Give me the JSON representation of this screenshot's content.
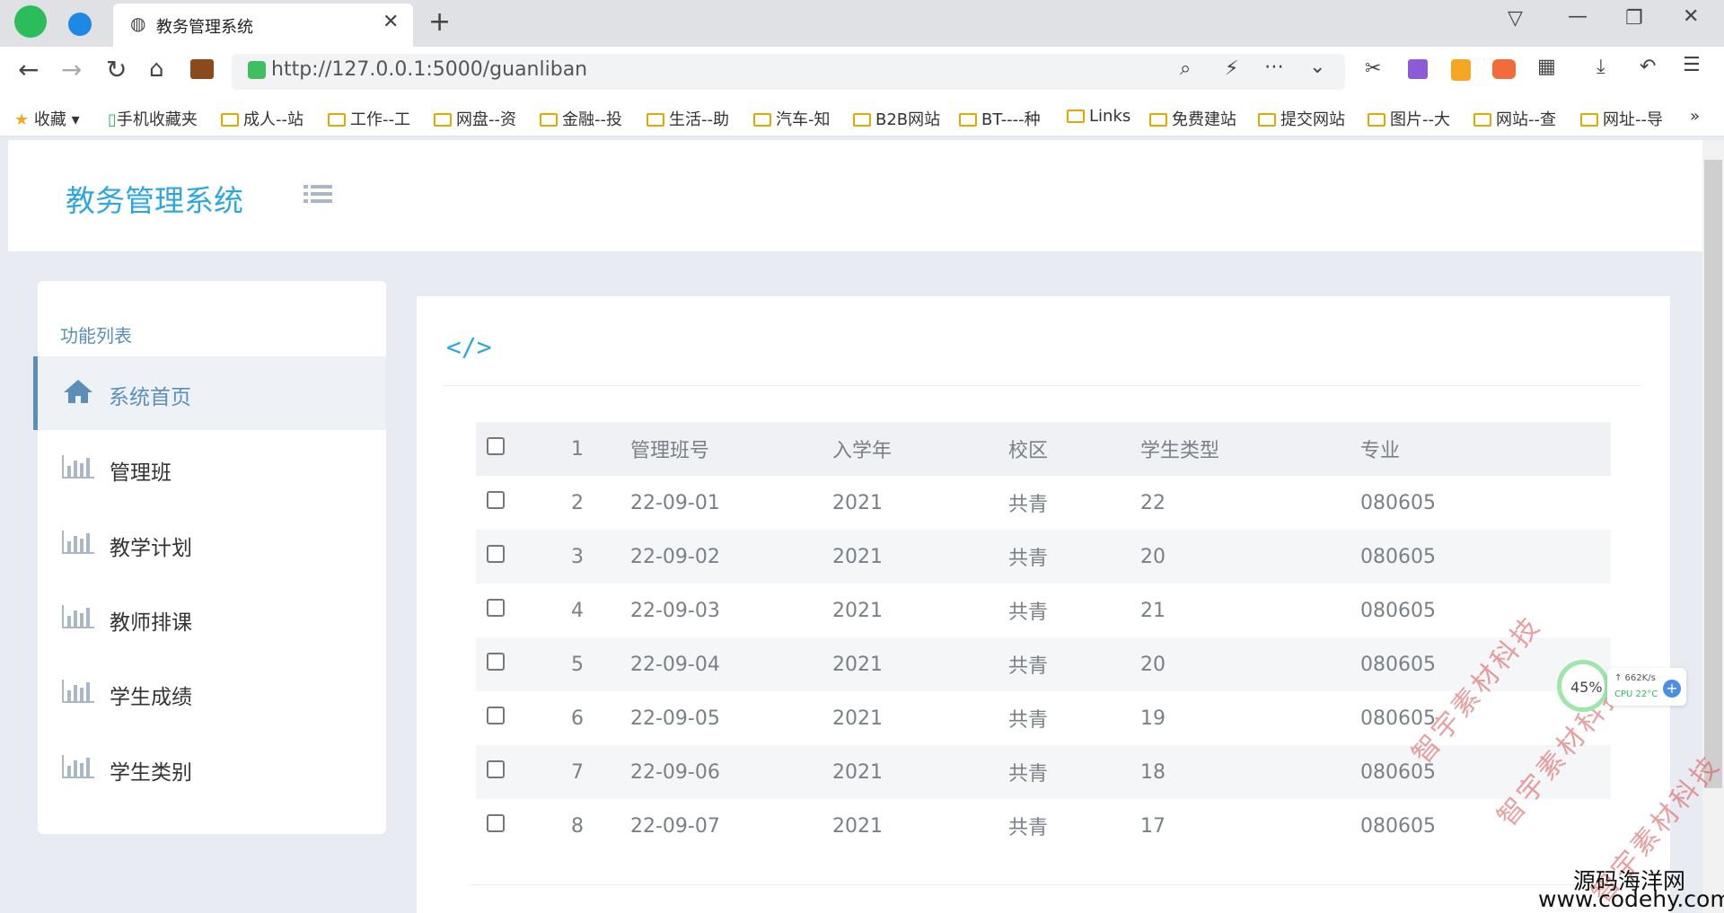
{
  "browser": {
    "tab_title": "教务管理系统",
    "url": "http://127.0.0.1:5000/guanliban",
    "bookmarks": [
      "收藏",
      "手机收藏夹",
      "成人--站",
      "工作--工",
      "网盘--资",
      "金融--投",
      "生活--助",
      "汽车-知",
      "B2B网站",
      "BT----种",
      "Links",
      "免费建站",
      "提交网站",
      "图片--大",
      "网站--查",
      "网址--导"
    ]
  },
  "header": {
    "brand": "教务管理系统"
  },
  "sidebar": {
    "title": "功能列表",
    "items": [
      {
        "label": "系统首页",
        "active": true
      },
      {
        "label": "管理班",
        "active": false
      },
      {
        "label": "教学计划",
        "active": false
      },
      {
        "label": "教师排课",
        "active": false
      },
      {
        "label": "学生成绩",
        "active": false
      },
      {
        "label": "学生类别",
        "active": false
      }
    ]
  },
  "table": {
    "header": {
      "num": "1",
      "class_no": "管理班号",
      "year": "入学年",
      "campus": "校区",
      "student_type": "学生类型",
      "major": "专业"
    },
    "rows": [
      {
        "num": "2",
        "class_no": "22-09-01",
        "year": "2021",
        "campus": "共青",
        "student_type": "22",
        "major": "080605"
      },
      {
        "num": "3",
        "class_no": "22-09-02",
        "year": "2021",
        "campus": "共青",
        "student_type": "20",
        "major": "080605"
      },
      {
        "num": "4",
        "class_no": "22-09-03",
        "year": "2021",
        "campus": "共青",
        "student_type": "21",
        "major": "080605"
      },
      {
        "num": "5",
        "class_no": "22-09-04",
        "year": "2021",
        "campus": "共青",
        "student_type": "20",
        "major": "080605"
      },
      {
        "num": "6",
        "class_no": "22-09-05",
        "year": "2021",
        "campus": "共青",
        "student_type": "19",
        "major": "080605"
      },
      {
        "num": "7",
        "class_no": "22-09-06",
        "year": "2021",
        "campus": "共青",
        "student_type": "18",
        "major": "080605"
      },
      {
        "num": "8",
        "class_no": "22-09-07",
        "year": "2021",
        "campus": "共青",
        "student_type": "17",
        "major": "080605"
      }
    ]
  },
  "overlay": {
    "watermark": "智宇素材科技",
    "monitor_pct": "45%",
    "monitor_net": "↑ 662K/s",
    "monitor_cpu": "CPU 22°C",
    "corner_line1": "源码海洋网",
    "corner_line2": "www.codehy.com"
  },
  "colors": {
    "accent": "#2ea7e0",
    "sidebar_active": "#5b8fb8"
  }
}
